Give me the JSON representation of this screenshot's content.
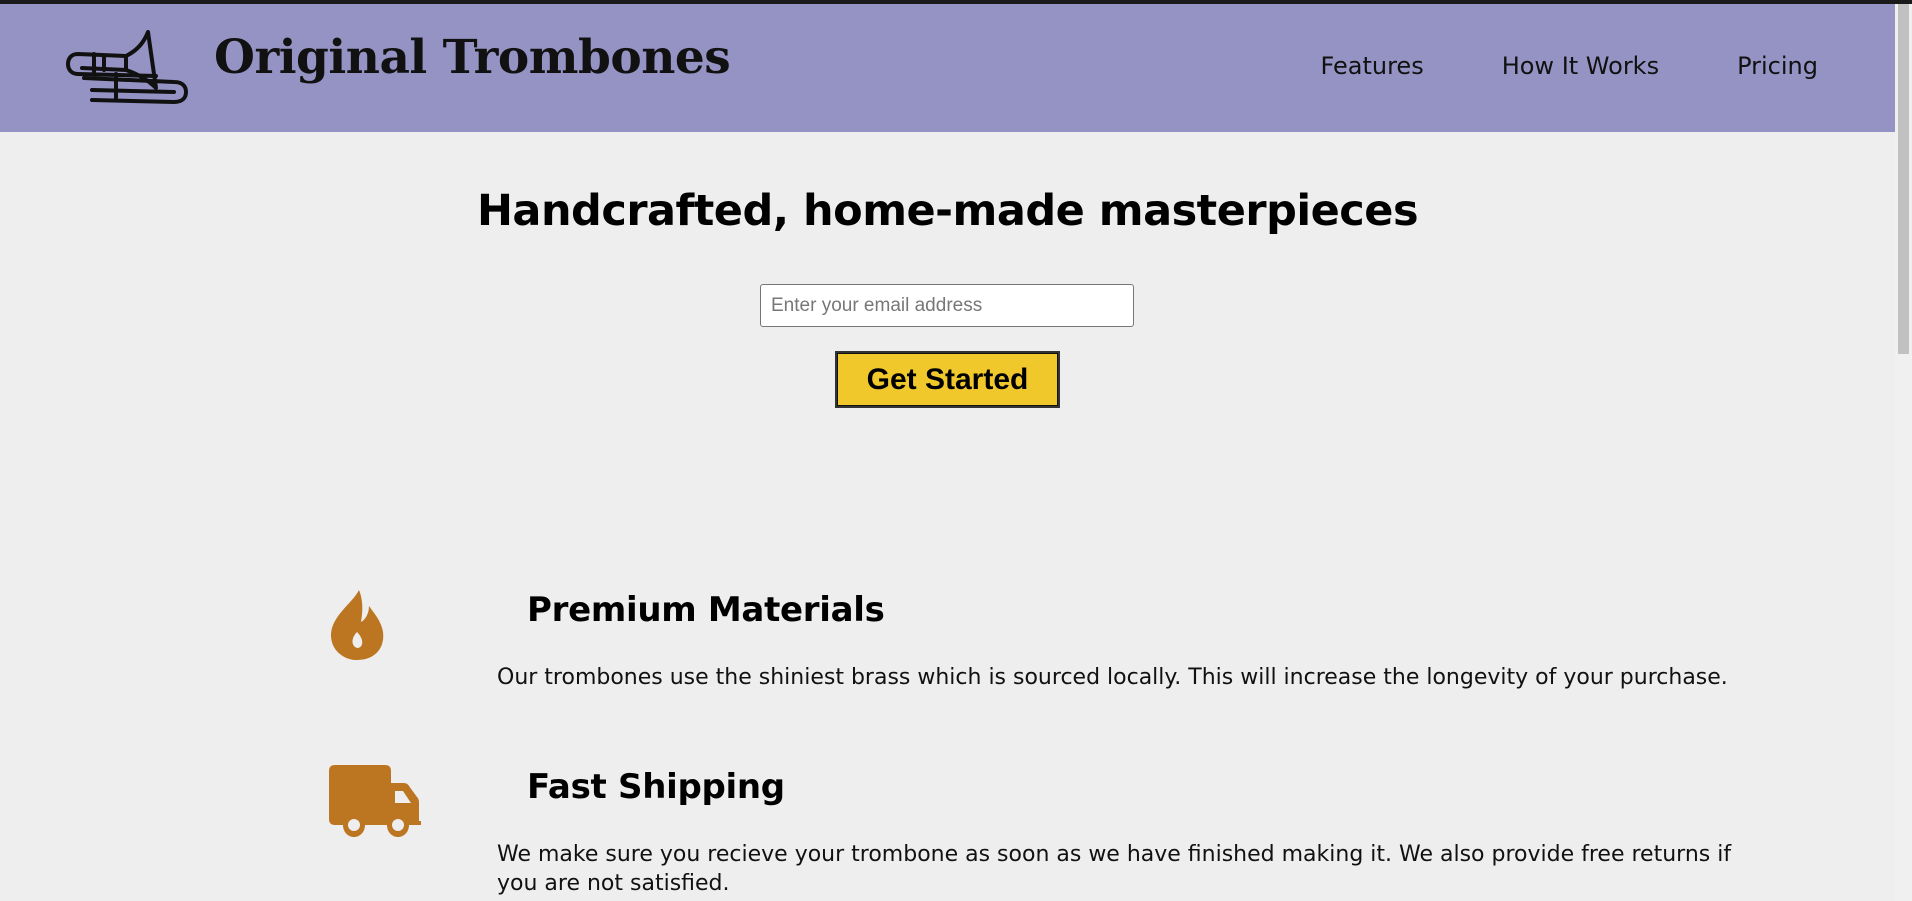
{
  "header": {
    "brand": "Original Trombones",
    "logo_icon": "trombone-icon",
    "background_color": "#9493c4",
    "nav": [
      {
        "label": "Features"
      },
      {
        "label": "How It Works"
      },
      {
        "label": "Pricing"
      }
    ]
  },
  "hero": {
    "title": "Handcrafted, home-made masterpieces",
    "email_placeholder": "Enter your email address",
    "email_value": "",
    "cta_label": "Get Started",
    "cta_color": "#f1c82c"
  },
  "features": [
    {
      "icon": "fire-icon",
      "title": "Premium Materials",
      "description": "Our trombones use the shiniest brass which is sourced locally. This will increase the longevity of your purchase."
    },
    {
      "icon": "truck-icon",
      "title": "Fast Shipping",
      "description": "We make sure you recieve your trombone as soon as we have finished making it. We also provide free returns if you are not satisfied."
    }
  ],
  "colors": {
    "page_background": "#eeeeee",
    "feature_icon": "#bc7520"
  }
}
